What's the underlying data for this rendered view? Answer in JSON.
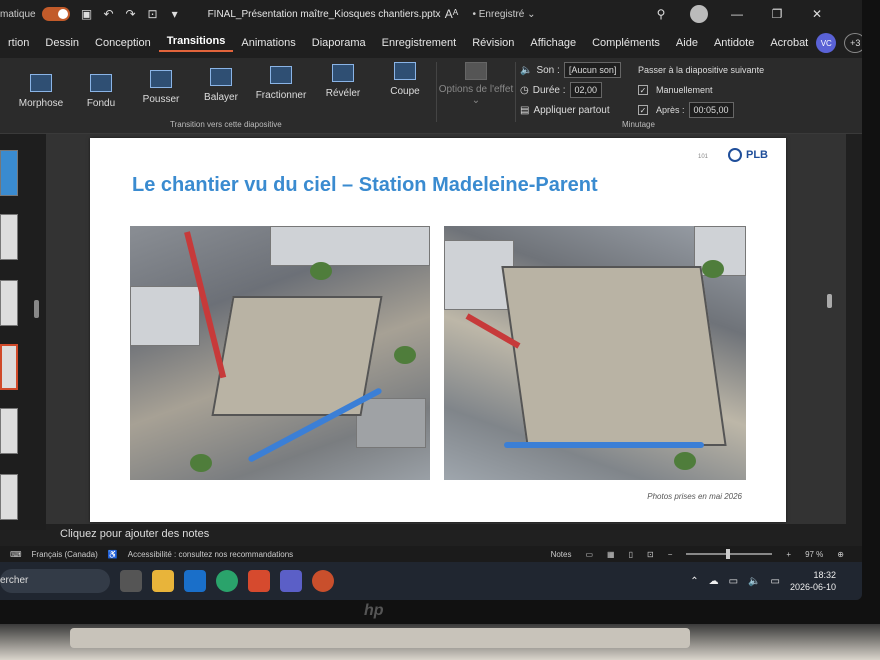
{
  "titlebar": {
    "autosave_label": "matique",
    "filename": "FINAL_Présentation maître_Kiosques chantiers.pptx",
    "save_status": "• Enregistré ⌄"
  },
  "tabs": [
    "rtion",
    "Dessin",
    "Conception",
    "Transitions",
    "Animations",
    "Diaporama",
    "Enregistrement",
    "Révision",
    "Affichage",
    "Compléments",
    "Aide",
    "Antidote",
    "Acrobat"
  ],
  "active_tab": "Transitions",
  "account": {
    "initials": "VC",
    "collaborators": "+3"
  },
  "ribbon": {
    "effects": [
      "Morphose",
      "Fondu",
      "Pousser",
      "Balayer",
      "Fractionner",
      "Révéler",
      "Coupe"
    ],
    "group_label": "Transition vers cette diapositive",
    "options_label": "Options de l'effet ⌄",
    "sound_label": "Son :",
    "sound_value": "[Aucun son]",
    "duration_label": "Durée :",
    "duration_value": "02,00",
    "apply_all": "Appliquer partout",
    "advance_title": "Passer à la diapositive suivante",
    "on_click_label": "Manuellement",
    "after_label": "Après :",
    "after_value": "00:05,00",
    "timing_group": "Minutage"
  },
  "slide": {
    "title": "Le chantier vu du ciel – Station  Madeleine-Parent",
    "number": "101",
    "logo_text": "PLB",
    "caption": "Photos prises en mai 2026"
  },
  "notes_placeholder": "Cliquez pour ajouter des notes",
  "status": {
    "language": "Français (Canada)",
    "accessibility": "Accessibilité : consultez nos recommandations",
    "notes_button": "Notes",
    "zoom": "97 %",
    "zoom_minus": "−",
    "zoom_plus": "+"
  },
  "taskbar": {
    "search_text": "ercher",
    "time": "18:32",
    "date": "2026-06-10"
  },
  "brand": "hp"
}
